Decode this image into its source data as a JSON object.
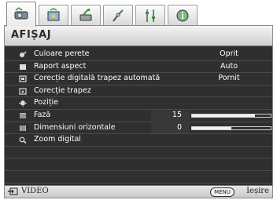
{
  "tabs": [
    {
      "icon": "display-settings-icon",
      "active": true
    },
    {
      "icon": "picture-settings-icon",
      "active": false
    },
    {
      "icon": "system-setup-icon",
      "active": false
    },
    {
      "icon": "advanced-setup-icon",
      "active": false
    },
    {
      "icon": "advanced-system-icon",
      "active": false
    },
    {
      "icon": "information-icon",
      "active": false
    }
  ],
  "header": {
    "title": "AFIȘAJ"
  },
  "menu": {
    "items": [
      {
        "label": "Culoare perete",
        "value": "Oprit",
        "icon": "wall-color-icon"
      },
      {
        "label": "Raport aspect",
        "value": "Auto",
        "icon": "aspect-ratio-icon"
      },
      {
        "label": "Corecție digitală trapez automată",
        "value": "Pornit",
        "icon": "auto-keystone-icon"
      },
      {
        "label": "Corecție trapez",
        "value": "",
        "icon": "keystone-icon"
      },
      {
        "label": "Poziție",
        "value": "",
        "icon": "position-icon"
      },
      {
        "label": "Fază",
        "value": "15",
        "level": 0.8,
        "icon": "phase-icon"
      },
      {
        "label": "Dimensiuni orizontale",
        "value": "0",
        "level": 0.5,
        "icon": "h-size-icon"
      },
      {
        "label": "Zoom digital",
        "value": "",
        "icon": "digital-zoom-icon"
      }
    ]
  },
  "footer": {
    "source": "VIDEO",
    "menu_key": "MENU",
    "exit": "Ieșire"
  },
  "colors": {
    "panel_bg": "#2f2f2f",
    "header_bg": "#dcdcdc",
    "text": "#ffffff"
  }
}
